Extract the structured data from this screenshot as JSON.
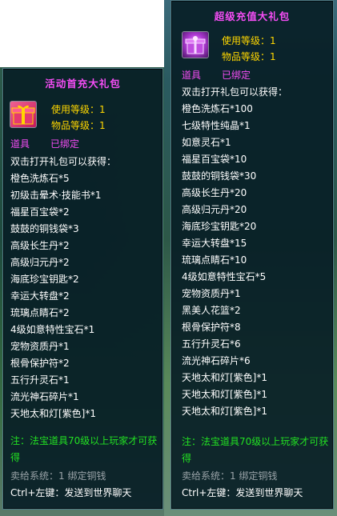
{
  "left_tooltip": {
    "title": "活动首充大礼包",
    "icon": "red-gift-box-icon",
    "use_level": "使用等级：1",
    "item_level": "物品等级：1",
    "item_type": "道具",
    "bound_status": "已绑定",
    "contents_header": "双击打开礼包可以获得：",
    "contents": [
      "橙色洗炼石*5",
      "初级击晕术·技能书*1",
      "福星百宝袋*2",
      "鼓鼓的铜钱袋*3",
      "高级长生丹*2",
      "高级归元丹*2",
      "海底珍宝钥匙*2",
      "幸运大转盘*2",
      "琉璃点睛石*2",
      "4级如意特性宝石*1",
      "宠物资质丹*1",
      "根骨保护符*2",
      "五行升灵石*1",
      "流光神石碎片*1",
      "天地太和灯[紫色]*1"
    ],
    "note": "注：法宝道具70级以上玩家才可获得",
    "sell_info": "卖给系统：1 绑定铜钱",
    "shortcut": "Ctrl+左键：发送到世界聊天"
  },
  "right_tooltip": {
    "title": "超级充值大礼包",
    "icon": "purple-gift-box-icon",
    "use_level": "使用等级：1",
    "item_level": "物品等级：1",
    "item_type": "道具",
    "bound_status": "已绑定",
    "contents_header": "双击打开礼包可以获得：",
    "contents": [
      "橙色洗炼石*100",
      "七级特性纯晶*1",
      "如意灵石*1",
      "福星百宝袋*10",
      "鼓鼓的铜钱袋*30",
      "高级长生丹*20",
      "高级归元丹*20",
      "海底珍宝钥匙*20",
      "幸运大转盘*15",
      "琉璃点睛石*10",
      "4级如意特性宝石*5",
      "宠物资质丹*1",
      "黑美人花篮*2",
      "根骨保护符*8",
      "五行升灵石*6",
      "流光神石碎片*6",
      "天地太和灯[紫色]*1",
      "天地太和灯[紫色]*1",
      "天地太和灯[紫色]*1"
    ],
    "note": "注：法宝道具70级以上玩家才可获得",
    "sell_info": "卖给系统：1 绑定铜钱",
    "shortcut": "Ctrl+左键：发送到世界聊天"
  },
  "colors": {
    "title": "#f54df5",
    "level_text": "#ffd700",
    "note_text": "#22e022",
    "sell_text": "#9aa3a8",
    "panel_bg": "#081e26",
    "panel_border": "#4f7b86"
  }
}
